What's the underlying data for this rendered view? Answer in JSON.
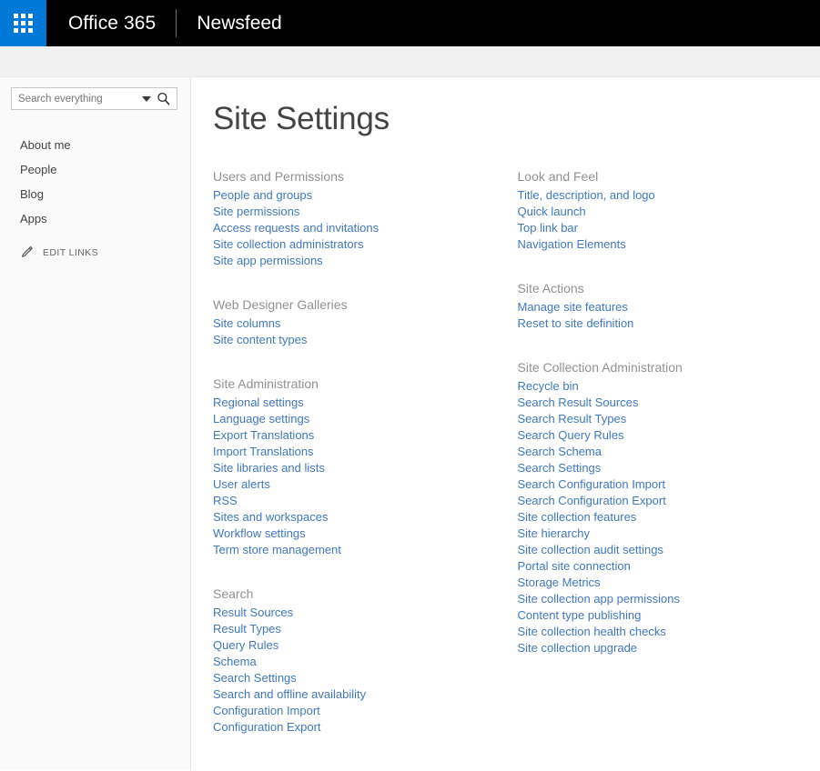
{
  "suite_bar": {
    "app_launcher_label": "app-launcher",
    "brand": "Office 365",
    "newsfeed": "Newsfeed"
  },
  "sidebar": {
    "search": {
      "placeholder": "Search everything",
      "value": ""
    },
    "nav_items": [
      {
        "label": "About me"
      },
      {
        "label": "People"
      },
      {
        "label": "Blog"
      },
      {
        "label": "Apps"
      }
    ],
    "edit_links_label": "EDIT LINKS"
  },
  "page": {
    "title": "Site Settings"
  },
  "colors": {
    "accent_blue": "#0078d7",
    "link_blue": "#4178be",
    "header_grey": "#919191",
    "suite_bar_black": "#000000",
    "band_grey": "#f1f1f1",
    "sidebar_bg": "#fafafa"
  },
  "left_column": [
    {
      "title": "Users and Permissions",
      "links": [
        "People and groups",
        "Site permissions",
        "Access requests and invitations",
        "Site collection administrators",
        "Site app permissions"
      ]
    },
    {
      "title": "Web Designer Galleries",
      "links": [
        "Site columns",
        "Site content types"
      ]
    },
    {
      "title": "Site Administration",
      "links": [
        "Regional settings",
        "Language settings",
        "Export Translations",
        "Import Translations",
        "Site libraries and lists",
        "User alerts",
        "RSS",
        "Sites and workspaces",
        "Workflow settings",
        "Term store management"
      ]
    },
    {
      "title": "Search",
      "links": [
        "Result Sources",
        "Result Types",
        "Query Rules",
        "Schema",
        "Search Settings",
        "Search and offline availability",
        "Configuration Import",
        "Configuration Export"
      ]
    }
  ],
  "right_column": [
    {
      "title": "Look and Feel",
      "links": [
        "Title, description, and logo",
        "Quick launch",
        "Top link bar",
        "Navigation Elements"
      ]
    },
    {
      "title": "Site Actions",
      "links": [
        "Manage site features",
        "Reset to site definition"
      ]
    },
    {
      "title": "Site Collection Administration",
      "links": [
        "Recycle bin",
        "Search Result Sources",
        "Search Result Types",
        "Search Query Rules",
        "Search Schema",
        "Search Settings",
        "Search Configuration Import",
        "Search Configuration Export",
        "Site collection features",
        "Site hierarchy",
        "Site collection audit settings",
        "Portal site connection",
        "Storage Metrics",
        "Site collection app permissions",
        "Content type publishing",
        "Site collection health checks",
        "Site collection upgrade"
      ]
    }
  ]
}
